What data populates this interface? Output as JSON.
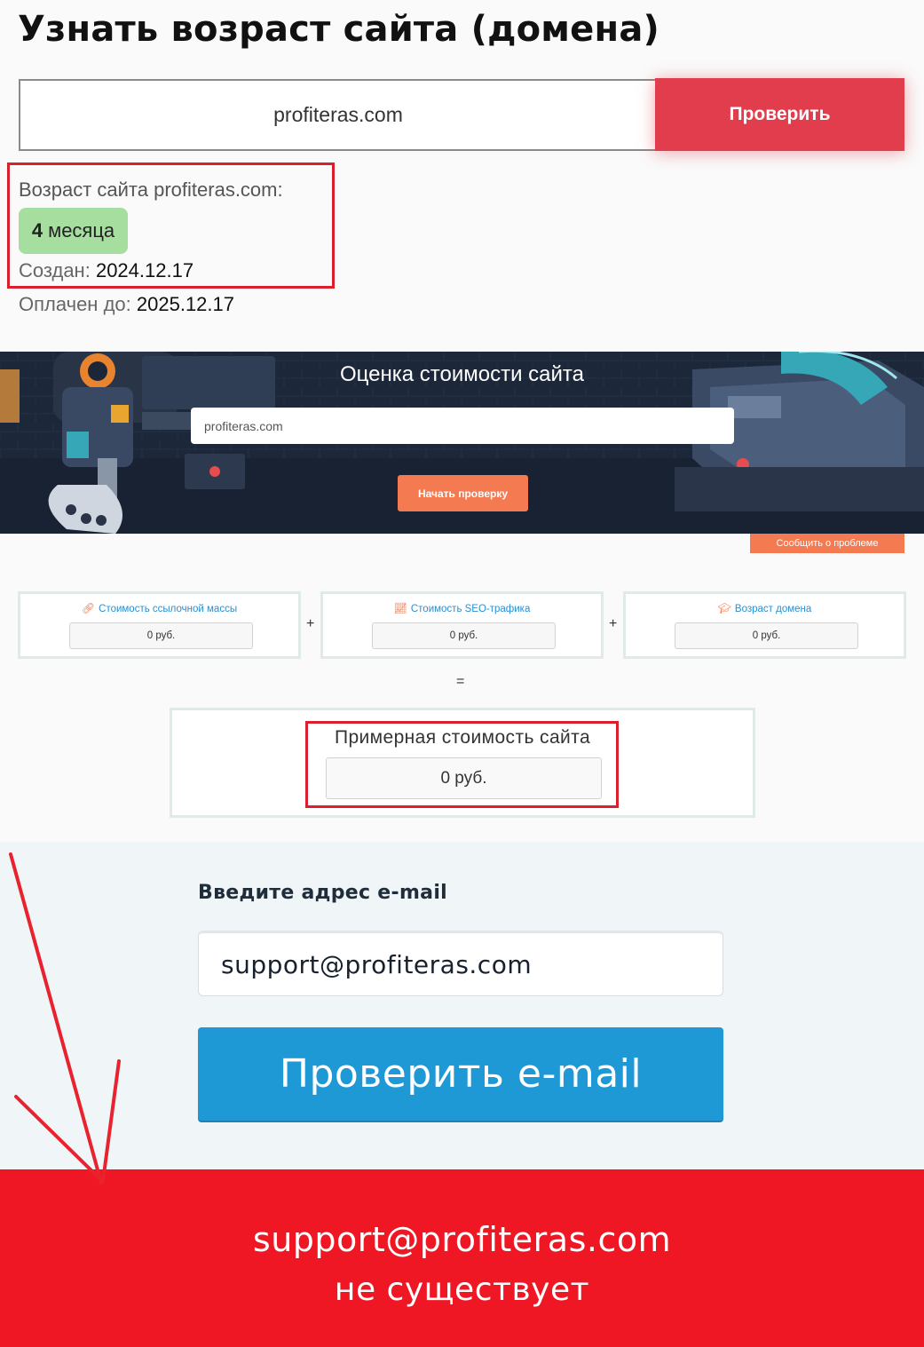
{
  "age_checker": {
    "title": "Узнать возраст сайта (домена)",
    "domain_input_value": "profiteras.com",
    "check_button": "Проверить",
    "result_label": "Возраст сайта profiteras.com:",
    "age_number": "4",
    "age_unit": "месяца",
    "created_label": "Создан:",
    "created_value": "2024.12.17",
    "paid_label": "Оплачен до:",
    "paid_value": "2025.12.17",
    "badge_color": "#a6dea0",
    "button_color": "#e13d4c"
  },
  "site_value": {
    "banner_title": "Оценка стоимости сайта",
    "input_value": "profiteras.com",
    "start_button": "Начать проверку",
    "report_button": "Сообщить о проблеме",
    "cards": [
      {
        "icon": "link-icon",
        "label": "Стоимость ссылочной массы",
        "value": "0 руб."
      },
      {
        "icon": "chart-icon",
        "label": "Стоимость SEO-трафика",
        "value": "0 руб."
      },
      {
        "icon": "graduation-cap-icon",
        "label": "Возраст домена",
        "value": "0 руб."
      }
    ],
    "plus": "+",
    "equals": "=",
    "total_label": "Примерная стоимость сайта",
    "total_value": "0 руб.",
    "accent_color": "#f47a52"
  },
  "email_checker": {
    "label": "Введите адрес e-mail",
    "input_value": "support@profiteras.com",
    "check_button": "Проверить e-mail",
    "result_email": "support@profiteras.com",
    "result_status": "не существует",
    "button_color": "#1f98d6",
    "result_color": "#ee1723"
  }
}
